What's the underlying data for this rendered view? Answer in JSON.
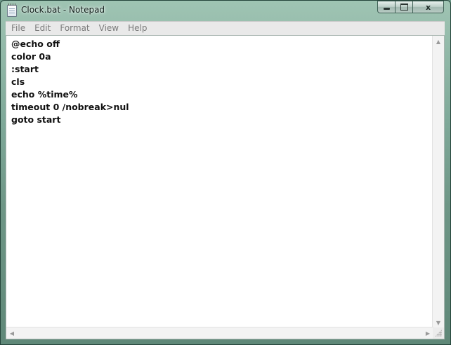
{
  "window": {
    "title": "Clock.bat - Notepad",
    "icon": "notepad-icon"
  },
  "controls": {
    "minimize": "minimize-icon",
    "maximize": "maximize-icon",
    "close": "close-icon",
    "close_glyph": "x"
  },
  "menu": {
    "items": [
      "File",
      "Edit",
      "Format",
      "View",
      "Help"
    ]
  },
  "document": {
    "lines": [
      "@echo off",
      "color 0a",
      ":start",
      "cls",
      "echo %time%",
      "timeout 0 /nobreak>nul",
      "goto start"
    ]
  },
  "scrollbars": {
    "up_arrow": "▲",
    "down_arrow": "▼",
    "left_arrow": "◀",
    "right_arrow": "▶"
  },
  "colors": {
    "frame": "#7fa999",
    "editor_bg": "#ffffff",
    "text": "#111111",
    "menu_text": "#7b7b7b"
  }
}
